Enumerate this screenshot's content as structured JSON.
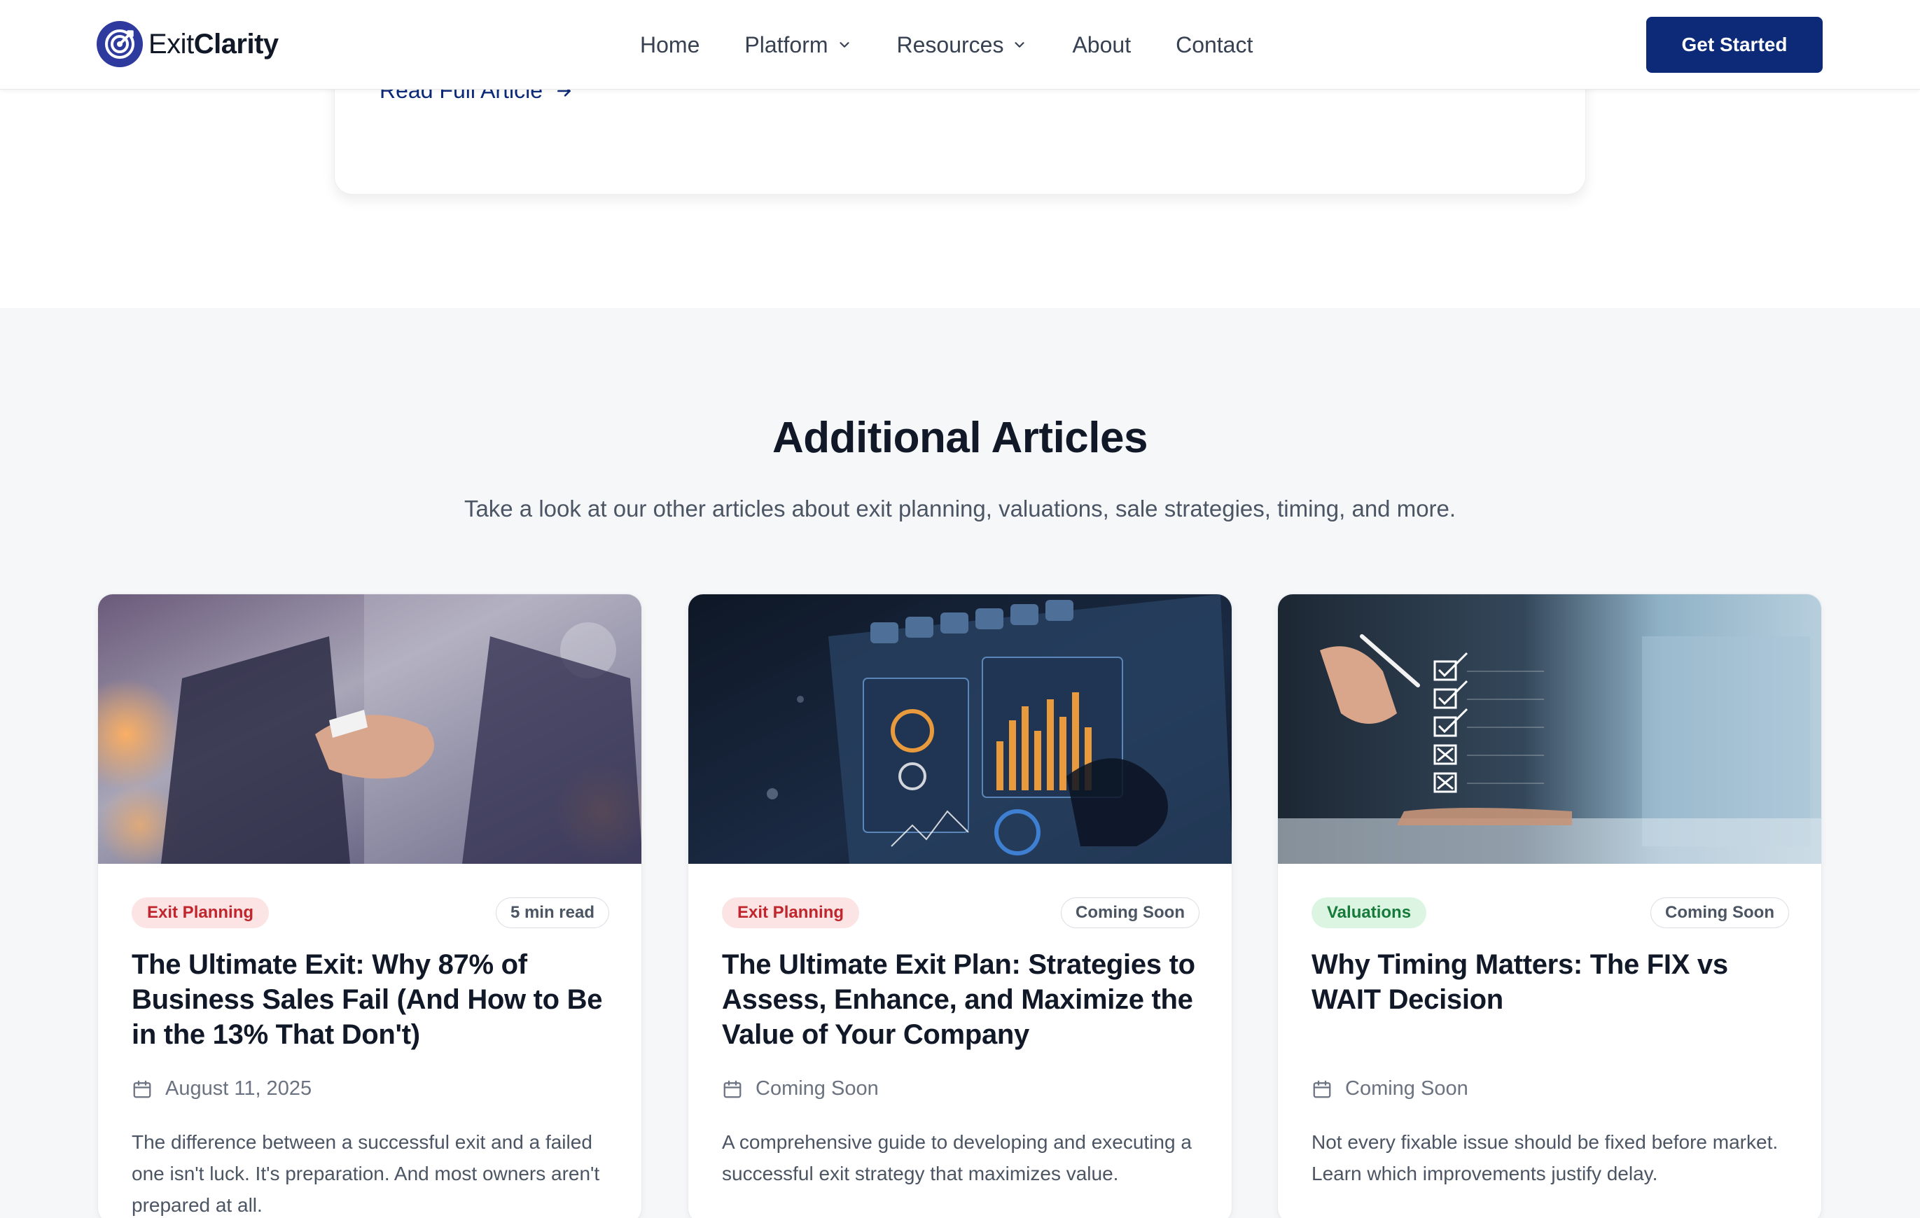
{
  "header": {
    "logo_prefix": "Exit",
    "logo_bold": "Clarity",
    "nav": [
      {
        "label": "Home"
      },
      {
        "label": "Platform",
        "icon": "chevron-down-icon"
      },
      {
        "label": "Resources",
        "icon": "chevron-down-icon"
      },
      {
        "label": "About"
      },
      {
        "label": "Contact"
      }
    ],
    "cta_label": "Get Started"
  },
  "featured": {
    "read_more_label": "Read Full Article",
    "read_more_icon": "arrow-right-icon"
  },
  "additional": {
    "title": "Additional Articles",
    "subtitle": "Take a look at our other articles about exit planning, valuations, sale strategies, timing, and more.",
    "cards": [
      {
        "image": "handshake-photo",
        "category": "Exit Planning",
        "category_color": "#c0262d",
        "read_time": "5 min read",
        "title": "The Ultimate Exit: Why 87% of Business Sales Fail (And How to Be in the 13% That Don't)",
        "date": "August 11, 2025",
        "description": "The difference between a successful exit and a failed one isn't luck. It's preparation. And most owners aren't prepared at all."
      },
      {
        "image": "financial-dashboard-photo",
        "category": "Exit Planning",
        "category_color": "#c0262d",
        "read_time": "Coming Soon",
        "title": "The Ultimate Exit Plan: Strategies to Assess, Enhance, and Maximize the Value of Your Company",
        "date": "Coming Soon",
        "description": "A comprehensive guide to developing and executing a successful exit strategy that maximizes value."
      },
      {
        "image": "checklist-tablet-photo",
        "category": "Valuations",
        "category_color": "#167a3a",
        "read_time": "Coming Soon",
        "title": "Why Timing Matters: The FIX vs WAIT Decision",
        "date": "Coming Soon",
        "description": "Not every fixable issue should be fixed before market. Learn which improvements justify delay."
      }
    ]
  },
  "colors": {
    "brand_navy": "#0c2a78",
    "logo_blue": "#2f3a9e",
    "section_bg": "#f6f7f9"
  }
}
